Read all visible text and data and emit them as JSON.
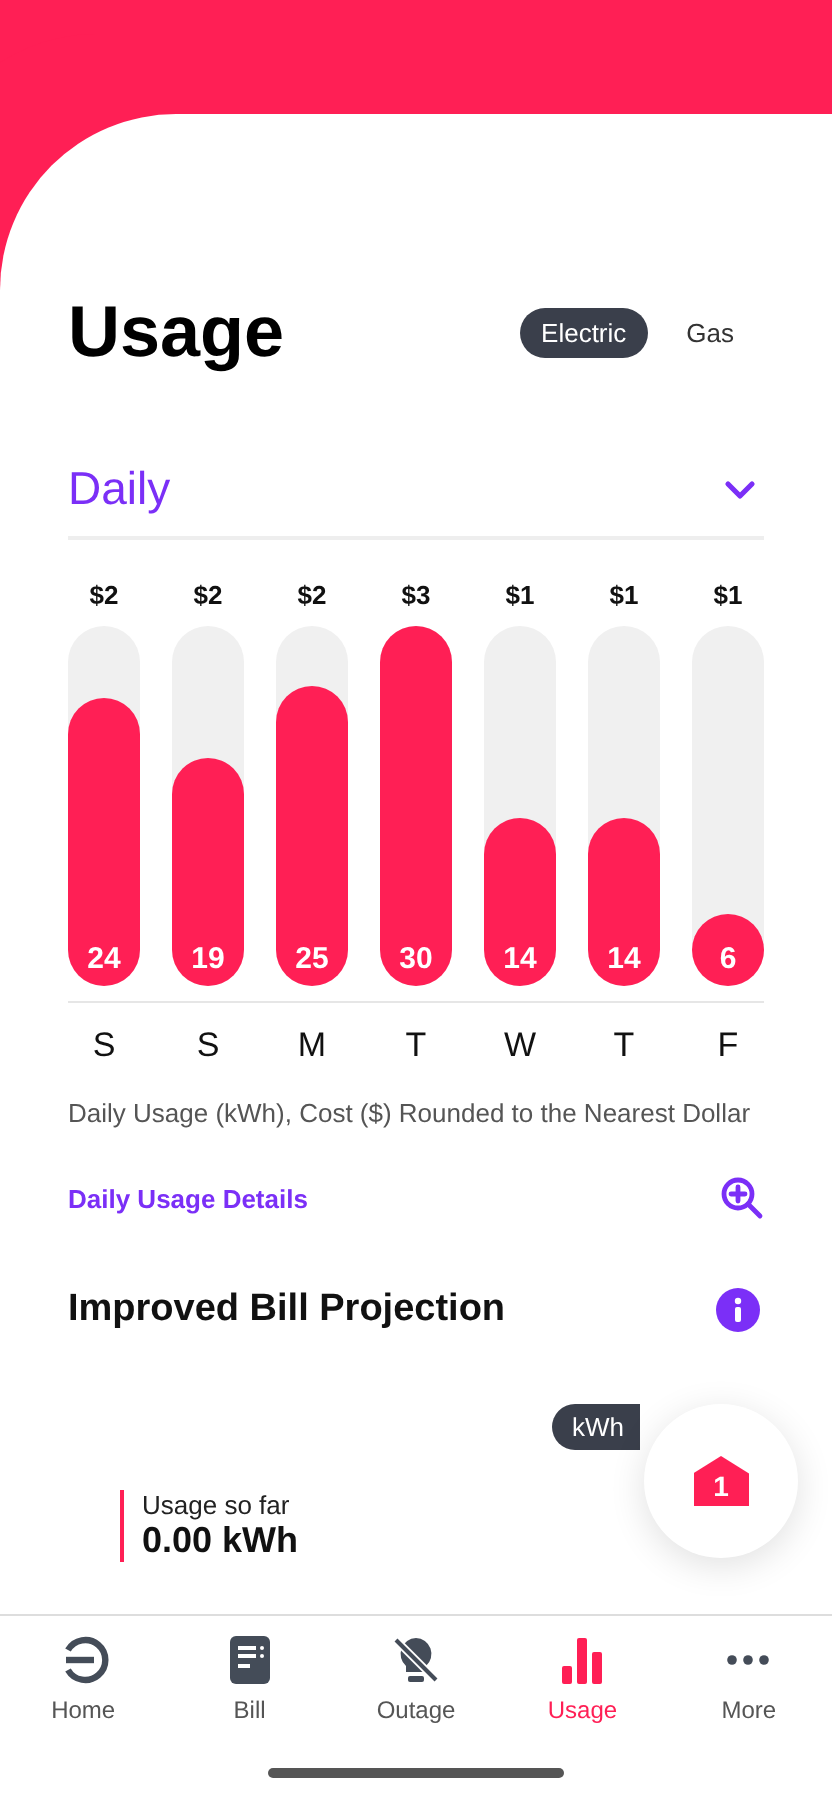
{
  "title": "Usage",
  "fuel_toggle": [
    {
      "label": "Electric",
      "selected": true
    },
    {
      "label": "Gas",
      "selected": false
    }
  ],
  "period_dropdown": {
    "value": "Daily"
  },
  "chart": {
    "costs": [
      "$2",
      "$2",
      "$2",
      "$3",
      "$1",
      "$1",
      "$1"
    ],
    "chart_data": {
      "type": "bar",
      "categories": [
        "S",
        "S",
        "M",
        "T",
        "W",
        "T",
        "F"
      ],
      "values": [
        24,
        19,
        25,
        30,
        14,
        14,
        6
      ],
      "ylim": [
        0,
        30
      ],
      "data_labels": true
    }
  },
  "caption": "Daily Usage (kWh), Cost ($) Rounded to the Nearest Dollar",
  "details_link": "Daily Usage Details",
  "projection": {
    "title": "Improved Bill Projection",
    "unit_toggle": "kWh",
    "usage_label": "Usage so far",
    "usage_value": "0.00 kWh"
  },
  "fab_badge": "1",
  "tab_bar": [
    {
      "label": "Home",
      "kind": "home",
      "selected": false
    },
    {
      "label": "Bill",
      "kind": "bill",
      "selected": false
    },
    {
      "label": "Outage",
      "kind": "outage",
      "selected": false
    },
    {
      "label": "Usage",
      "kind": "usage",
      "selected": true
    },
    {
      "label": "More",
      "kind": "more",
      "selected": false
    }
  ]
}
